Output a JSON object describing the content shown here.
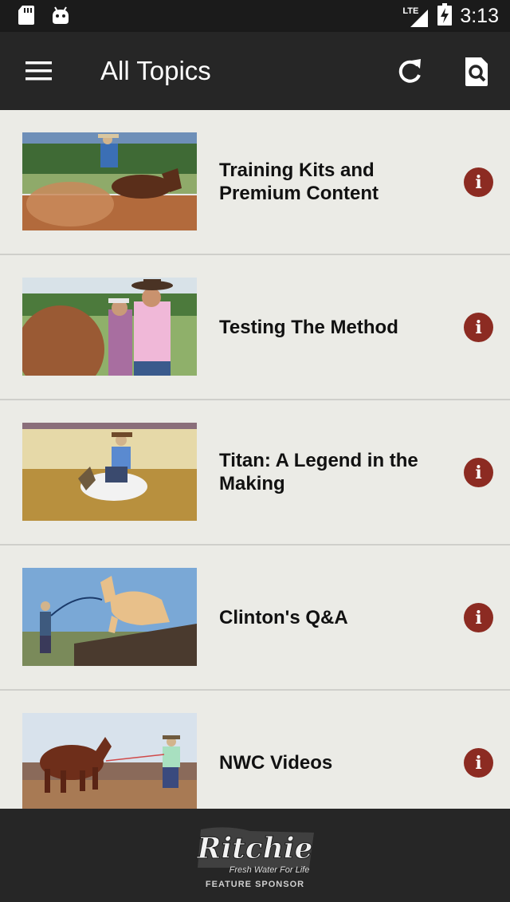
{
  "status_bar": {
    "network_label": "LTE",
    "time": "3:13",
    "icons": [
      "sd-card-icon",
      "android-icon",
      "signal-icon",
      "battery-charging-icon"
    ]
  },
  "app_bar": {
    "title": "All Topics",
    "icons": [
      "menu-icon",
      "refresh-icon",
      "search-icon"
    ]
  },
  "topics": [
    {
      "title": "Training Kits and Premium Content",
      "thumbnail": "horse sliding stop in dirt arena"
    },
    {
      "title": "Testing The Method",
      "thumbnail": "couple with horse outdoors"
    },
    {
      "title": "Titan: A Legend in the Making",
      "thumbnail": "white horse sliding stop in indoor arena"
    },
    {
      "title": "Clinton's Q&A",
      "thumbnail": "palomino horse jumping obstacle"
    },
    {
      "title": "NWC Videos",
      "thumbnail": "horse lunging exercise"
    }
  ],
  "sponsor": {
    "brand": "Ritchie",
    "tagline": "Fresh Water For Life",
    "label": "FEATURE SPONSOR"
  },
  "colors": {
    "app_bar": "#262626",
    "status_bar": "#1b1b1b",
    "list_background": "#ebebe6",
    "info_button": "#8c2b22"
  }
}
